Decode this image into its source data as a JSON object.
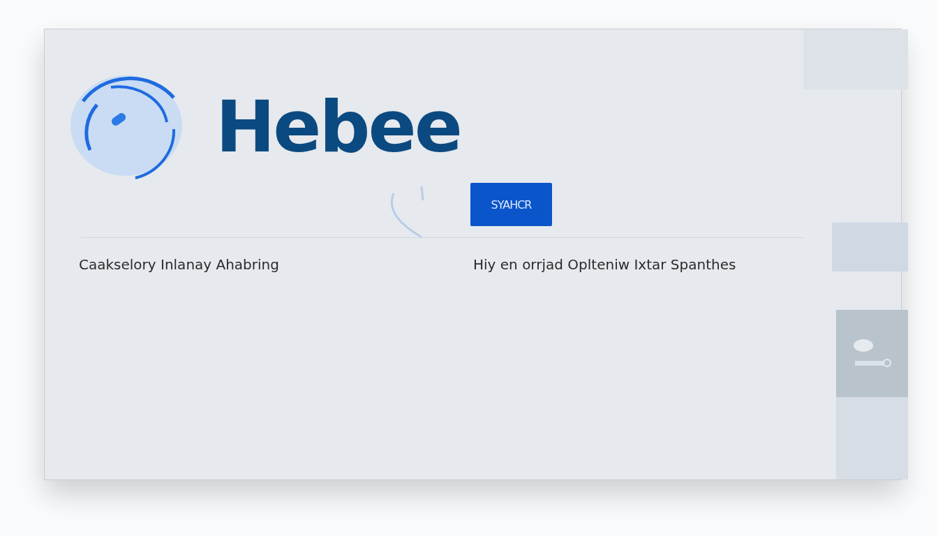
{
  "header": {
    "logo_text": "Hebee",
    "button": "SYAHCR"
  },
  "captions": [
    "Caakselory Inlanay Ahabring",
    "Hiy en orrjad Oplteniw Ixtar Spanthes"
  ]
}
